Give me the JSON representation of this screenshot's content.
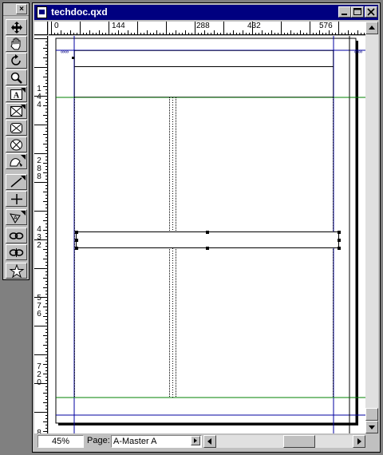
{
  "window": {
    "title": "techdoc.qxd",
    "minimize": "_",
    "maximize": "□",
    "close": "×"
  },
  "palette": {
    "close": "×",
    "tools": [
      {
        "name": "item-tool",
        "icon": "move-arrows-icon"
      },
      {
        "name": "content-tool",
        "icon": "hand-icon"
      },
      {
        "name": "rotation-tool",
        "icon": "rotate-icon"
      },
      {
        "name": "zoom-tool",
        "icon": "magnifier-icon"
      },
      {
        "name": "text-box-tool",
        "icon": "text-box-icon",
        "label": "A"
      },
      {
        "name": "picture-box-tool",
        "icon": "rect-picture-box-icon"
      },
      {
        "name": "rounded-picture-box-tool",
        "icon": "rounded-picture-box-icon"
      },
      {
        "name": "oval-picture-box-tool",
        "icon": "oval-picture-box-icon"
      },
      {
        "name": "bezier-picture-box-tool",
        "icon": "bezier-picture-box-icon"
      },
      {
        "name": "line-tool",
        "icon": "line-icon"
      },
      {
        "name": "orthogonal-line-tool",
        "icon": "orthogonal-line-icon"
      },
      {
        "name": "text-path-tool",
        "icon": "text-path-icon"
      },
      {
        "name": "linking-tool",
        "icon": "link-icon"
      },
      {
        "name": "unlinking-tool",
        "icon": "unlink-icon"
      },
      {
        "name": "starburst-tool",
        "icon": "star-icon"
      }
    ]
  },
  "rulers": {
    "horizontal_labels": [
      "0",
      "144",
      "288",
      "432",
      "576"
    ],
    "vertical_labels": [
      [
        "1",
        "4",
        "4"
      ],
      [
        "2",
        "8",
        "8"
      ],
      [
        "4",
        "3",
        "2"
      ],
      [
        "5",
        "7",
        "6"
      ],
      [
        "7",
        "2",
        "0"
      ],
      [
        "8"
      ]
    ]
  },
  "status": {
    "zoom": "45%",
    "page_label": "Page:",
    "page_value": "A-Master A"
  },
  "colors": {
    "titlebar": "#000080",
    "chrome": "#c0c0c0",
    "margin_guide": "#0000a0",
    "ruler_guide": "#008000"
  }
}
